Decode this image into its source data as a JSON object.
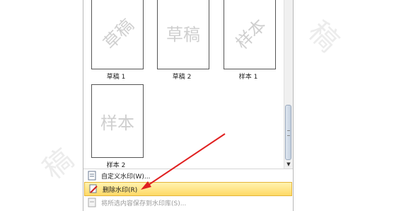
{
  "watermark_gallery": {
    "items": [
      {
        "watermark": "草稿",
        "caption": "草稿 1"
      },
      {
        "watermark": "草稿",
        "caption": "草稿 2"
      },
      {
        "watermark": "样本",
        "caption": "样本 1"
      },
      {
        "watermark": "样本",
        "caption": "样本 2"
      }
    ]
  },
  "menu": {
    "custom_watermark": "自定义水印(W)...",
    "remove_watermark": "删除水印(R)",
    "save_to_gallery": "将所选内容保存到水印库(S)..."
  },
  "colors": {
    "highlight_top": "#fff3b0",
    "highlight_bottom": "#ffd966",
    "arrow": "#e02020"
  }
}
